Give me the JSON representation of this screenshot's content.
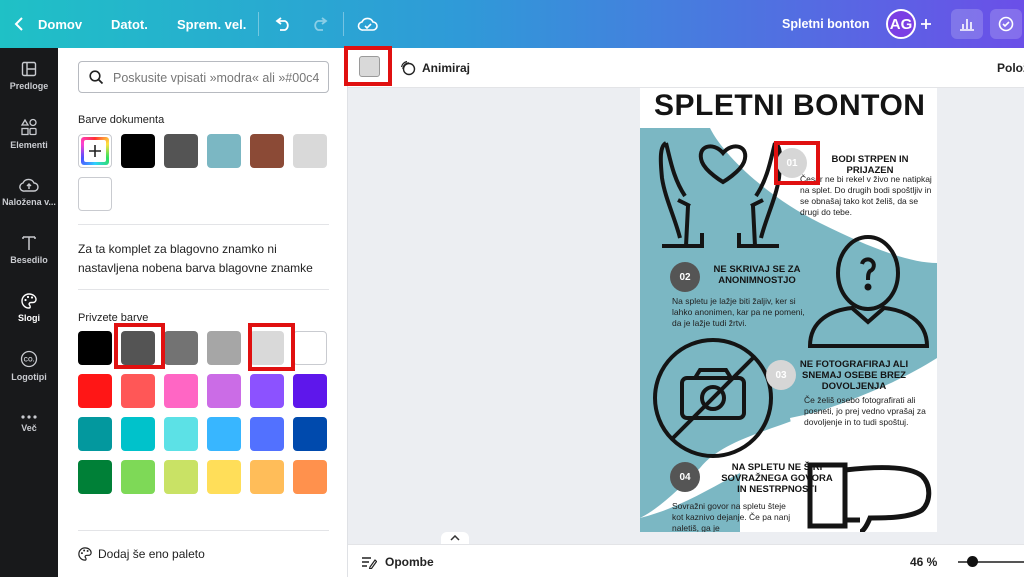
{
  "topbar": {
    "home_label": "Domov",
    "file_label": "Datot.",
    "resize_label": "Sprem. vel.",
    "design_title": "Spletni bonton",
    "avatar_initials": "AG",
    "gradient_colors": [
      "#1fc1c6",
      "#2f9ad8",
      "#6b4fe8"
    ]
  },
  "rail": {
    "items": [
      {
        "label": "Predloge",
        "icon": "template-icon"
      },
      {
        "label": "Elementi",
        "icon": "elements-icon"
      },
      {
        "label": "Naložena v...",
        "icon": "upload-icon"
      },
      {
        "label": "Besedilo",
        "icon": "text-icon"
      },
      {
        "label": "Slogi",
        "icon": "palette-icon",
        "active": true
      },
      {
        "label": "Logotipi",
        "icon": "logo-icon"
      },
      {
        "label": "Več",
        "icon": "more-icon"
      }
    ]
  },
  "panel": {
    "search_placeholder": "Poskusite vpisati »modra« ali »#00c4",
    "document_colors_title": "Barve dokumenta",
    "document_colors": [
      "#000000",
      "#545454",
      "#7bb7c3",
      "#8b4a36",
      "#d9d9d9",
      "#ffffff"
    ],
    "brand_note": "Za ta komplet za blagovno znamko ni nastavljena nobena barva blagovne znamke",
    "default_colors_title": "Privzete barve",
    "default_colors": [
      [
        "#000000",
        "#545454",
        "#737373",
        "#a6a6a6",
        "#d9d9d9",
        "#ffffff"
      ],
      [
        "#ff1616",
        "#ff5757",
        "#ff66c4",
        "#cb6ce6",
        "#8c52ff",
        "#5e17eb"
      ],
      [
        "#03989e",
        "#00c2cb",
        "#5ce1e6",
        "#38b6ff",
        "#5271ff",
        "#004aad"
      ],
      [
        "#008037",
        "#7ed957",
        "#c9e265",
        "#ffde59",
        "#ffbd59",
        "#ff914d"
      ]
    ],
    "add_palette_label": "Dodaj še eno paleto"
  },
  "toolbar": {
    "animate_label": "Animiraj",
    "position_label": "Polož",
    "selected_color": "#d9d9d9"
  },
  "bottombar": {
    "notes_label": "Opombe",
    "zoom_label": "46 %",
    "zoom_percent": 46
  },
  "poster": {
    "title": "SPLETNI BONTON",
    "accent_color": "#7bb7c3",
    "items": [
      {
        "num": "01",
        "heading": "BODI STRPEN IN PRIJAZEN",
        "text": "Česar ne bi rekel v živo ne natipkaj na splet. Do drugih bodi spoštljiv in se obnašaj tako kot želiš, da se drugi do tebe."
      },
      {
        "num": "02",
        "heading": "NE SKRIVAJ SE ZA ANONIMNOSTJO",
        "text": "Na spletu je lažje biti žaljiv, ker si lahko anonimen, kar pa ne pomeni, da je lažje tudi žrtvi."
      },
      {
        "num": "03",
        "heading": "NE FOTOGRAFIRAJ ALI SNEMAJ OSEBE BREZ DOVOLJENJA",
        "text": "Če želiš osebo fotografirati ali posneti, jo prej vedno vprašaj za dovoljenje in to tudi spoštuj."
      },
      {
        "num": "04",
        "heading": "NA SPLETU NE ŠIRI SOVRAŽNEGA GOVORA IN NESTRPNOSTI",
        "text": "Sovražni govor na spletu šteje kot kaznivo dejanje. Če pa nanj naletiš, ga je"
      }
    ]
  }
}
